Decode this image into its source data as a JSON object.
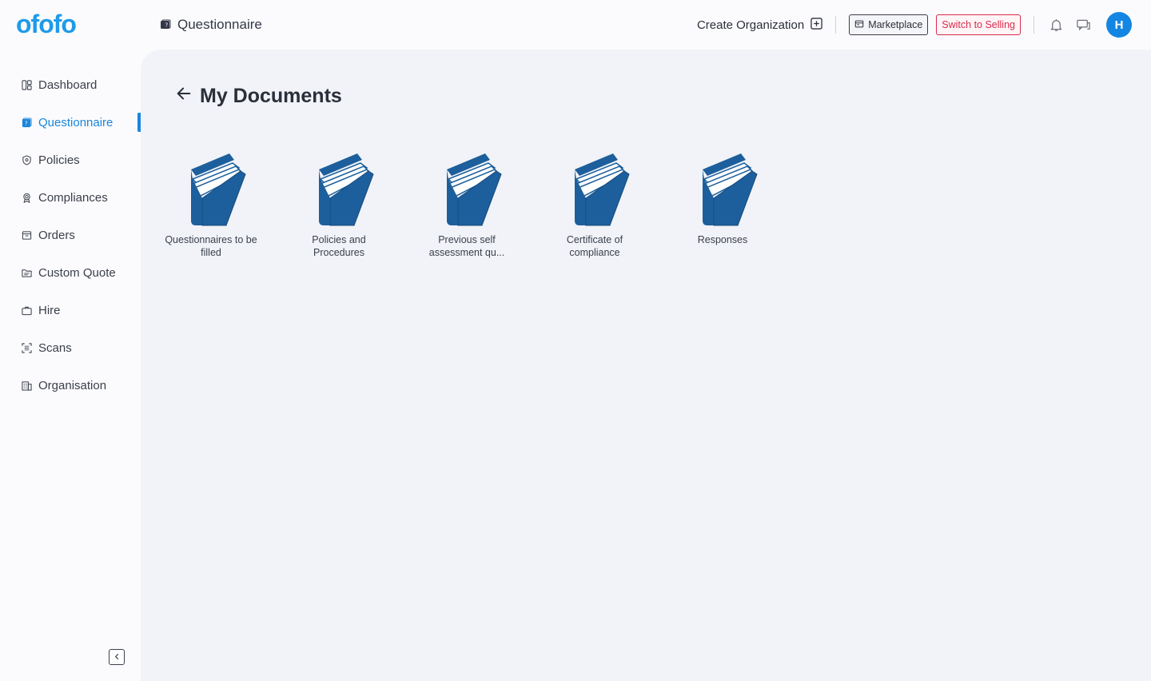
{
  "brand": {
    "logo_text": "ofofo",
    "color": "#1e9be9"
  },
  "header": {
    "page_title": "Questionnaire",
    "create_org_label": "Create Organization",
    "marketplace_label": "Marketplace",
    "switch_label": "Switch to Selling",
    "avatar_initial": "H"
  },
  "sidebar": {
    "items": [
      {
        "label": "Dashboard",
        "icon": "dashboard-icon"
      },
      {
        "label": "Questionnaire",
        "icon": "questionnaire-icon",
        "active": true
      },
      {
        "label": "Policies",
        "icon": "shield-icon"
      },
      {
        "label": "Compliances",
        "icon": "badge-icon"
      },
      {
        "label": "Orders",
        "icon": "orders-icon"
      },
      {
        "label": "Custom Quote",
        "icon": "folder-icon"
      },
      {
        "label": "Hire",
        "icon": "briefcase-icon"
      },
      {
        "label": "Scans",
        "icon": "scan-icon"
      },
      {
        "label": "Organisation",
        "icon": "building-icon"
      }
    ]
  },
  "main": {
    "title": "My Documents",
    "folders": [
      {
        "label": "Questionnaires to be filled"
      },
      {
        "label": "Policies and Procedures"
      },
      {
        "label": "Previous self assessment qu..."
      },
      {
        "label": "Certificate of compliance"
      },
      {
        "label": "Responses"
      }
    ]
  },
  "colors": {
    "accent": "#1a86dd",
    "folder": "#1d5f9c",
    "danger": "#d92a4b"
  }
}
